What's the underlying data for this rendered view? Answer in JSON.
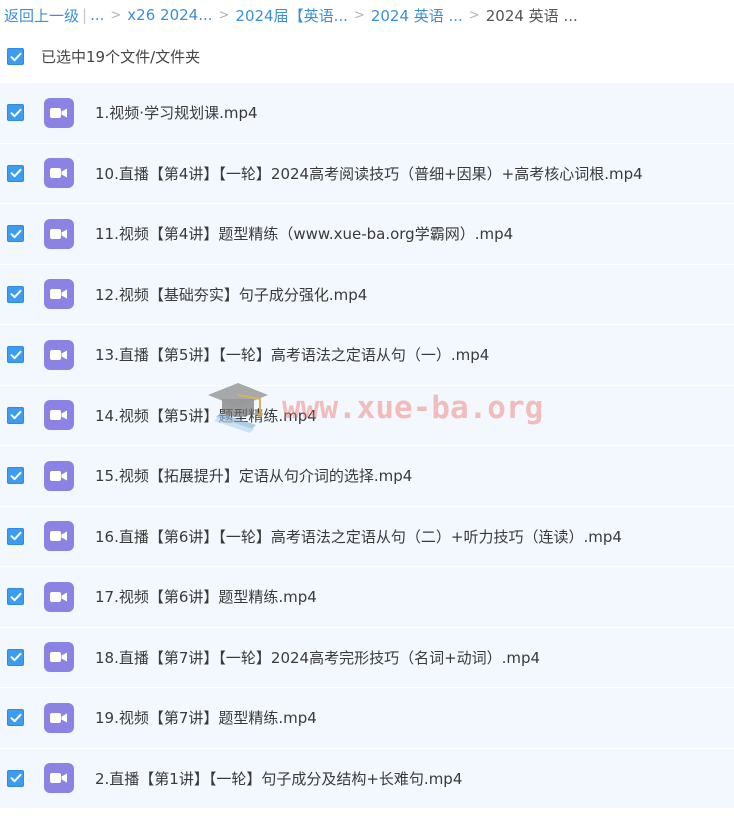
{
  "breadcrumb": {
    "back_label": "返回上一级",
    "ellipsis": "...",
    "crumbs": [
      "x26 2024...",
      "2024届【英语...",
      "2024 英语 ...",
      "2024 英语 ..."
    ]
  },
  "selection": {
    "summary": "已选中19个文件/文件夹"
  },
  "files": [
    {
      "name": "1.视频·学习规划课.mp4"
    },
    {
      "name": "10.直播【第4讲】【一轮】2024高考阅读技巧（普细+因果）+高考核心词根.mp4"
    },
    {
      "name": "11.视频【第4讲】题型精练（www.xue-ba.org学霸网）.mp4"
    },
    {
      "name": "12.视频【基础夯实】句子成分强化.mp4"
    },
    {
      "name": "13.直播【第5讲】【一轮】高考语法之定语从句（一）.mp4"
    },
    {
      "name": "14.视频【第5讲】题型精练.mp4"
    },
    {
      "name": "15.视频【拓展提升】定语从句介词的选择.mp4"
    },
    {
      "name": "16.直播【第6讲】【一轮】高考语法之定语从句（二）+听力技巧（连读）.mp4"
    },
    {
      "name": "17.视频【第6讲】题型精练.mp4"
    },
    {
      "name": "18.直播【第7讲】【一轮】2024高考完形技巧（名词+动词）.mp4"
    },
    {
      "name": "19.视频【第7讲】题型精练.mp4"
    },
    {
      "name": "2.直播【第1讲】【一轮】句子成分及结构+长难句.mp4"
    }
  ],
  "watermark": {
    "text": "www.xue-ba.org",
    "icon": "graduation-cap-icon"
  },
  "colors": {
    "link": "#3b8fd9",
    "checkbox": "#3b9cf0",
    "row_bg": "#f2f8fe",
    "video_icon": "#8b82e3"
  }
}
